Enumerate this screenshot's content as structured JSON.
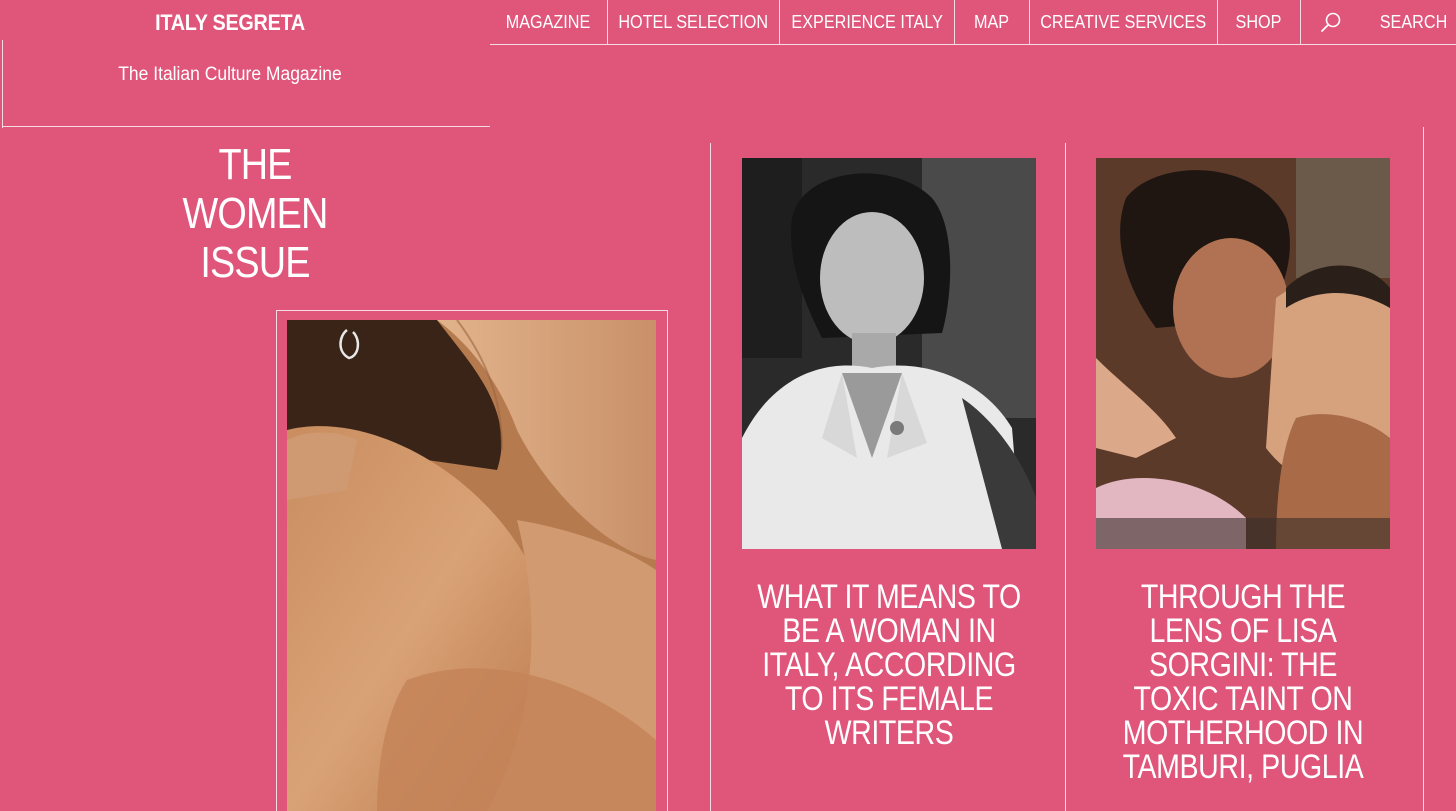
{
  "brand": {
    "title": "ITALY SEGRETA",
    "tagline": "The Italian Culture Magazine"
  },
  "nav": {
    "items": [
      {
        "label": "MAGAZINE"
      },
      {
        "label": "HOTEL SELECTION"
      },
      {
        "label": "EXPERIENCE ITALY"
      },
      {
        "label": "MAP"
      },
      {
        "label": "CREATIVE SERVICES"
      },
      {
        "label": "SHOP"
      }
    ],
    "search_icon": "search-icon",
    "search_label": "SEARCH"
  },
  "feature": {
    "issue_lines": [
      "THE",
      "WOMEN",
      "ISSUE"
    ]
  },
  "cards": [
    {
      "title": "WHAT IT MEANS TO BE A WOMAN IN ITALY, ACCORDING TO ITS FEMALE WRITERS"
    },
    {
      "title": "THROUGH THE LENS OF LISA SORGINI: THE TOXIC TAINT ON MOTHERHOOD IN TAMBURI, PUGLIA"
    }
  ],
  "colors": {
    "background": "#e0557a",
    "text": "#ffffff",
    "rule": "#f6dbe3"
  }
}
